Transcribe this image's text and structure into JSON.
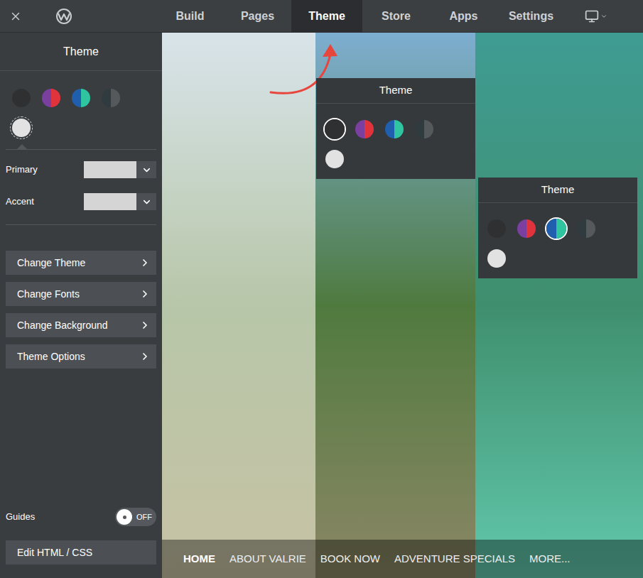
{
  "topbar": {
    "tabs": [
      {
        "label": "Build",
        "selected": false
      },
      {
        "label": "Pages",
        "selected": false
      },
      {
        "label": "Theme",
        "selected": true
      },
      {
        "label": "Store",
        "selected": false
      },
      {
        "label": "Apps",
        "selected": false
      },
      {
        "label": "Settings",
        "selected": false
      }
    ]
  },
  "sidebar": {
    "title": "Theme",
    "swatches": [
      {
        "color": "#2e3032",
        "color2": "#2e3032",
        "selected": false
      },
      {
        "color": "#7b3fa0",
        "color2": "#e0333c",
        "selected": false
      },
      {
        "color": "#1f5fae",
        "color2": "#2fc5a0",
        "selected": false
      },
      {
        "color": "#2f3b3f",
        "color2": "#55595c",
        "selected": false
      },
      {
        "color": "#e2e2e2",
        "color2": "#e2e2e2",
        "selected": true
      }
    ],
    "fields": [
      {
        "label": "Primary"
      },
      {
        "label": "Accent"
      }
    ],
    "buttons": [
      "Change Theme",
      "Change Fonts",
      "Change Background",
      "Theme Options"
    ],
    "guides": {
      "label": "Guides",
      "on": false,
      "state": "OFF"
    },
    "edit_button": "Edit HTML / CSS"
  },
  "preview": {
    "theme_panels": [
      {
        "title": "Theme",
        "swatches": [
          {
            "color": "#2e3032",
            "color2": "#2e3032",
            "selected": true
          },
          {
            "color": "#7b3fa0",
            "color2": "#e0333c",
            "selected": false
          },
          {
            "color": "#1f5fae",
            "color2": "#2fc5a0",
            "selected": false
          },
          {
            "color": "#2f3b3f",
            "color2": "#55595c",
            "selected": false
          },
          {
            "color": "#e2e2e2",
            "color2": "#e2e2e2",
            "selected": false
          }
        ]
      },
      {
        "title": "Theme",
        "swatches": [
          {
            "color": "#2e3032",
            "color2": "#2e3032",
            "selected": false
          },
          {
            "color": "#7b3fa0",
            "color2": "#e0333c",
            "selected": false
          },
          {
            "color": "#1f5fae",
            "color2": "#2fc5a0",
            "selected": true
          },
          {
            "color": "#2f3b3f",
            "color2": "#55595c",
            "selected": false
          },
          {
            "color": "#e2e2e2",
            "color2": "#e2e2e2",
            "selected": false
          }
        ]
      }
    ],
    "nav": [
      {
        "label": "HOME",
        "selected": true
      },
      {
        "label": "ABOUT VALRIE",
        "selected": false
      },
      {
        "label": "BOOK NOW",
        "selected": false
      },
      {
        "label": "ADVENTURE SPECIALS",
        "selected": false
      },
      {
        "label": "MORE...",
        "selected": false
      }
    ]
  }
}
